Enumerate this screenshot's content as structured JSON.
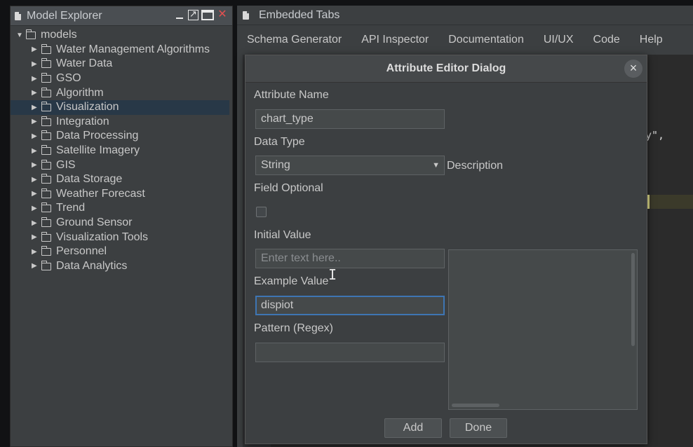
{
  "model_explorer": {
    "title": "Model Explorer",
    "close_glyph": "✕",
    "tree": {
      "root": "models",
      "items": [
        "Water Management Algorithms",
        "Water Data",
        "GSO",
        "Algorithm",
        "Visualization",
        "Integration",
        "Data Processing",
        "Satellite Imagery",
        "GIS",
        "Data Storage",
        "Weather Forecast",
        "Trend",
        "Ground Sensor",
        "Visualization Tools",
        "Personnel",
        "Data Analytics"
      ],
      "selected_index": 4
    }
  },
  "embedded_tabs": {
    "title": "Embedded Tabs",
    "tabs": [
      "Schema Generator",
      "API Inspector",
      "Documentation",
      "UI/UX",
      "Code",
      "Help"
    ],
    "active_tab": "Code",
    "code_fragment": "y\","
  },
  "dialog": {
    "title": "Attribute Editor Dialog",
    "close_glyph": "×",
    "attribute_name": {
      "label": "Attribute Name",
      "value": "chart_type"
    },
    "data_type": {
      "label": "Data Type",
      "value": "String",
      "description_label": "Description"
    },
    "field_optional": {
      "label": "Field Optional",
      "checked": false
    },
    "initial_value": {
      "label": "Initial Value",
      "placeholder": "Enter text here.."
    },
    "example_value": {
      "label": "Example Value",
      "value": "dispiot"
    },
    "pattern": {
      "label": "Pattern (Regex)",
      "value": ""
    },
    "buttons": {
      "add": "Add",
      "done": "Done"
    },
    "cursor_glyph": "I"
  }
}
